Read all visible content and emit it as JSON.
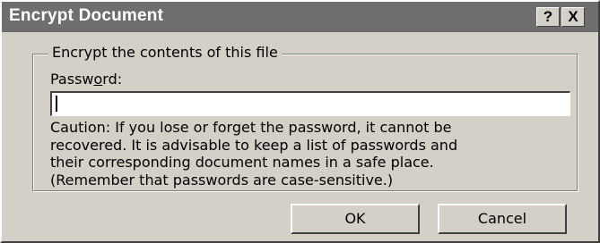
{
  "window": {
    "title": "Encrypt Document",
    "help_glyph": "?",
    "close_glyph": "X"
  },
  "group": {
    "label": "Encrypt the contents of this file"
  },
  "password": {
    "label_pre": "Passw",
    "label_accel": "o",
    "label_post": "rd:",
    "value": ""
  },
  "caution": {
    "text": "Caution: If you lose or forget the password, it cannot be\nrecovered. It is advisable to keep a list of passwords and\ntheir corresponding document names in a safe place.\n(Remember that passwords are case-sensitive.)"
  },
  "buttons": {
    "ok_label": "OK",
    "cancel_label": "Cancel"
  },
  "colors": {
    "title_bar": "#6e6e6e",
    "dialog_face": "#d4d0c8",
    "input_background": "#ffffff"
  }
}
